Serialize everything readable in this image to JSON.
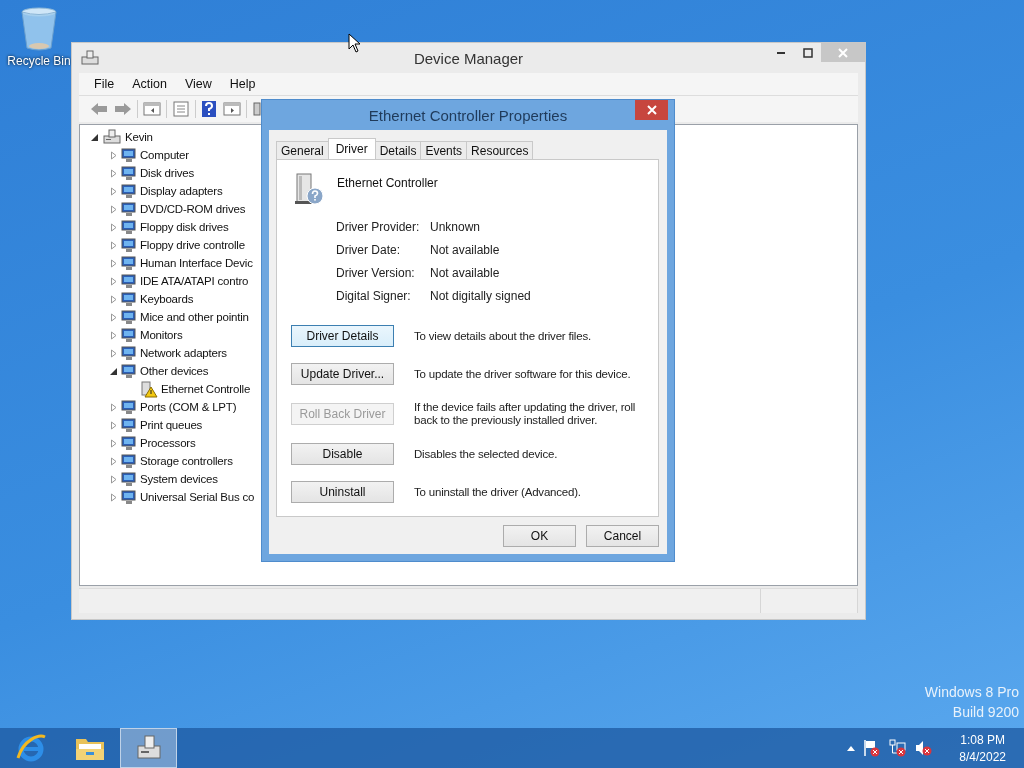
{
  "desktop": {
    "icons": [
      {
        "label": "Recycle Bin"
      }
    ],
    "edition": [
      "Windows 8 Pro",
      "Build 9200"
    ]
  },
  "device_manager": {
    "title": "Device Manager",
    "menu": [
      "File",
      "Action",
      "View",
      "Help"
    ],
    "tree": {
      "label": "Kevin",
      "expanded": true,
      "children": [
        {
          "label": "Computer",
          "expanded": false
        },
        {
          "label": "Disk drives",
          "expanded": false
        },
        {
          "label": "Display adapters",
          "expanded": false
        },
        {
          "label": "DVD/CD-ROM drives",
          "expanded": false
        },
        {
          "label": "Floppy disk drives",
          "expanded": false
        },
        {
          "label": "Floppy drive controlle",
          "expanded": false
        },
        {
          "label": "Human Interface Devic",
          "expanded": false
        },
        {
          "label": "IDE ATA/ATAPI contro",
          "expanded": false
        },
        {
          "label": "Keyboards",
          "expanded": false
        },
        {
          "label": "Mice and other pointin",
          "expanded": false
        },
        {
          "label": "Monitors",
          "expanded": false
        },
        {
          "label": "Network adapters",
          "expanded": false
        },
        {
          "label": "Other devices",
          "expanded": true,
          "children": [
            {
              "label": "Ethernet Controlle",
              "warning": true
            }
          ]
        },
        {
          "label": "Ports (COM & LPT)",
          "expanded": false
        },
        {
          "label": "Print queues",
          "expanded": false
        },
        {
          "label": "Processors",
          "expanded": false
        },
        {
          "label": "Storage controllers",
          "expanded": false
        },
        {
          "label": "System devices",
          "expanded": false
        },
        {
          "label": "Universal Serial Bus co",
          "expanded": false
        }
      ]
    }
  },
  "dialog": {
    "title": "Ethernet Controller Properties",
    "tabs": [
      {
        "label": "General",
        "selected": false
      },
      {
        "label": "Driver",
        "selected": true
      },
      {
        "label": "Details",
        "selected": false
      },
      {
        "label": "Events",
        "selected": false
      },
      {
        "label": "Resources",
        "selected": false
      }
    ],
    "device_name": "Ethernet Controller",
    "properties": [
      {
        "label": "Driver Provider:",
        "value": "Unknown"
      },
      {
        "label": "Driver Date:",
        "value": "Not available"
      },
      {
        "label": "Driver Version:",
        "value": "Not available"
      },
      {
        "label": "Digital Signer:",
        "value": "Not digitally signed"
      }
    ],
    "actions": [
      {
        "button": "Driver Details",
        "description": "To view details about the driver files.",
        "disabled": false
      },
      {
        "button": "Update Driver...",
        "description": "To update the driver software for this device.",
        "disabled": false
      },
      {
        "button": "Roll Back Driver",
        "description": "If the device fails after updating the driver, roll back to the previously installed driver.",
        "disabled": true
      },
      {
        "button": "Disable",
        "description": "Disables the selected device.",
        "disabled": false
      },
      {
        "button": "Uninstall",
        "description": "To uninstall the driver (Advanced).",
        "disabled": false
      }
    ],
    "buttons": [
      "OK",
      "Cancel"
    ]
  },
  "taskbar": {
    "apps": [
      {
        "selected": false
      },
      {
        "selected": false
      },
      {
        "selected": true
      }
    ],
    "time": "1:08 PM",
    "date": "8/4/2022"
  }
}
